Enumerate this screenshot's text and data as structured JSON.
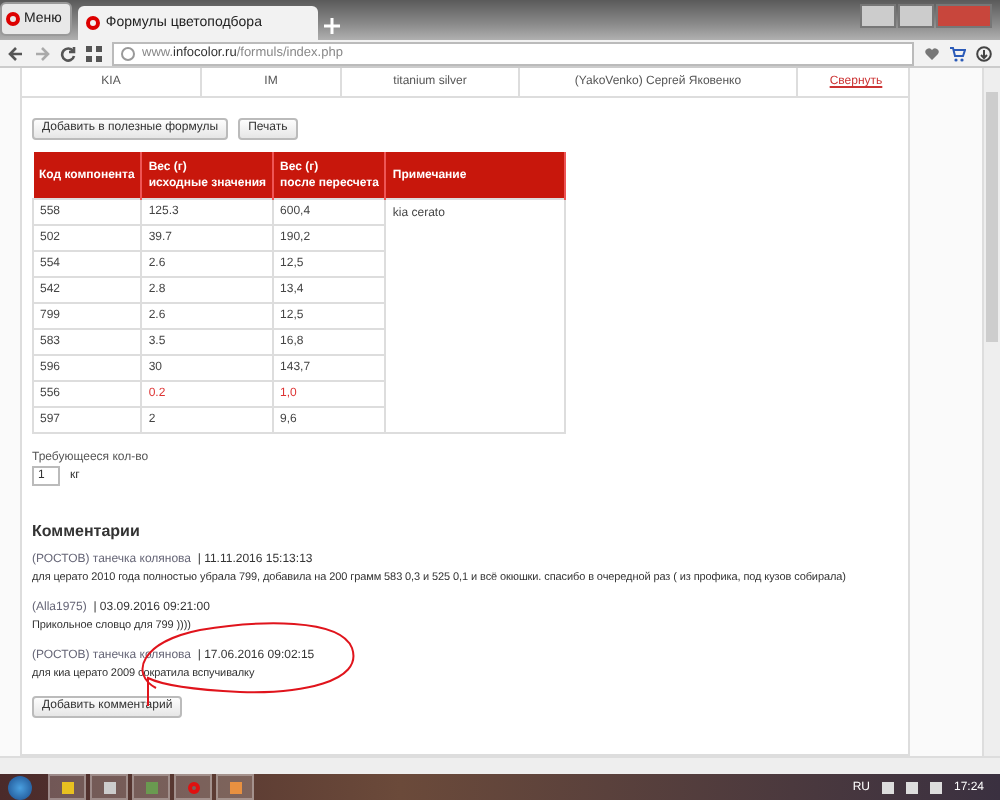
{
  "browser": {
    "menu": "Меню",
    "tab_title": "Формулы цветоподбора",
    "url": "www.**infocolor.ru**/formuls/index.php"
  },
  "summary_row": {
    "cells": [
      "KIA",
      "IM",
      "titanium silver",
      "(YakoVenko) Сергей Яковенко"
    ],
    "collapse_link": "Свернуть"
  },
  "buttons": [
    "Добавить в полезные формулы",
    "Печать"
  ],
  "table": {
    "columns": [
      {
        "title": "Код компонента"
      },
      {
        "title": "Вес (г)",
        "subtitle": "исходные значения"
      },
      {
        "title": "Вес (г)",
        "subtitle": "после пересчета"
      },
      {
        "title": "Примечание"
      }
    ],
    "note": "kia cerato",
    "rows": [
      {
        "code": "558",
        "original": "125.3",
        "recalculated": "600,4",
        "highlight": false
      },
      {
        "code": "502",
        "original": "39.7",
        "recalculated": "190,2",
        "highlight": false
      },
      {
        "code": "554",
        "original": "2.6",
        "recalculated": "12,5",
        "highlight": false
      },
      {
        "code": "542",
        "original": "2.8",
        "recalculated": "13,4",
        "highlight": false
      },
      {
        "code": "799",
        "original": "2.6",
        "recalculated": "12,5",
        "highlight": false
      },
      {
        "code": "583",
        "original": "3.5",
        "recalculated": "16,8",
        "highlight": false
      },
      {
        "code": "596",
        "original": "30",
        "recalculated": "143,7",
        "highlight": false
      },
      {
        "code": "556",
        "original": "0.2",
        "recalculated": "1,0",
        "highlight": true
      },
      {
        "code": "597",
        "original": "2",
        "recalculated": "9,6",
        "highlight": false
      }
    ]
  },
  "quantity": {
    "label": "Требующееся кол-во",
    "value": "1",
    "unit": "кг"
  },
  "comments": {
    "heading": "Комментарии",
    "items": [
      {
        "author": "(РОСТОВ) танечка колянова",
        "date": "| 11.11.2016 15:13:13",
        "text": "для церато 2010 года полностью убрала 799, добавила на 200 грамм 583 0,3 и 525 0,1 и всё окюшки. спасибо в очередной раз ( из профика, под кузов собирала)"
      },
      {
        "author": "(Alla1975)",
        "date": "| 03.09.2016 09:21:00",
        "text": "Прикольное словцо для 799 ))))"
      },
      {
        "author": "(РОСТОВ) танечка колянова",
        "date": "| 17.06.2016 09:02:15",
        "text": "для киа церато 2009 сократила вспучивалку"
      }
    ],
    "add_button": "Добавить комментарий"
  },
  "taskbar": {
    "language": "RU",
    "time": "17:24"
  }
}
